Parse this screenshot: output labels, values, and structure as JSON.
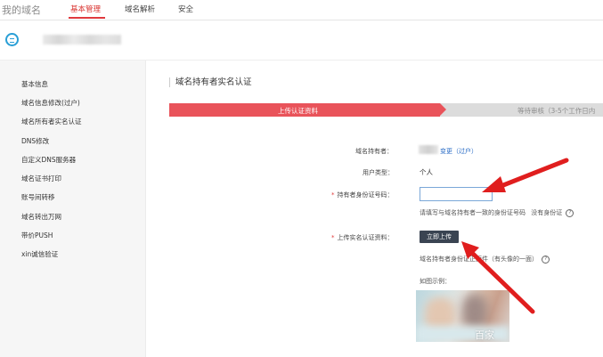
{
  "nav": {
    "title": "我的域名",
    "tabs": [
      {
        "label": "基本管理"
      },
      {
        "label": "域名解析"
      },
      {
        "label": "安全"
      }
    ]
  },
  "sidebar": {
    "items": [
      {
        "label": "基本信息"
      },
      {
        "label": "域名信息修改(过户)"
      },
      {
        "label": "域名所有者实名认证"
      },
      {
        "label": "DNS修改"
      },
      {
        "label": "自定义DNS服务器"
      },
      {
        "label": "域名证书打印"
      },
      {
        "label": "账号间转移"
      },
      {
        "label": "域名转出万网"
      },
      {
        "label": "带价PUSH"
      },
      {
        "label": "xin诚信验证"
      }
    ]
  },
  "main": {
    "section_title": "域名持有者实名认证",
    "steps": [
      {
        "label": "上传认证资料"
      },
      {
        "label": "等待审核（3-5个工作日内"
      }
    ],
    "fields": {
      "holder_label": "域名持有者：",
      "holder_link": "变更（过户）",
      "user_type_label": "用户类型：",
      "user_type_value": "个人",
      "id_label": "持有者身份证号码：",
      "id_value": "",
      "id_hint": "请填写与域名持有者一致的身份证号码",
      "no_id_link": "没有身份证",
      "upload_label": "上传实名认证资料：",
      "upload_button": "立即上传",
      "upload_hint": "域名持有者身份证正面件（有头像的一面）",
      "example_label": "如图示例："
    },
    "watermark": "百家"
  },
  "colors": {
    "accent_red": "#e0393e",
    "step_active": "#e9535a",
    "step_inactive": "#dcdcdc",
    "link_blue": "#2a6cc6",
    "button_dark": "#3a4452",
    "annotation_red": "#e01e1e"
  },
  "icons": {
    "domain_logo": "globe-icon",
    "question": "question-circle-icon",
    "annotation": "red-arrow-icon"
  }
}
